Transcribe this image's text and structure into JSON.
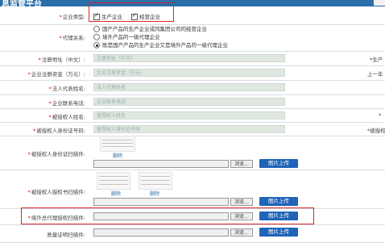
{
  "header": {
    "title": "息监管平台"
  },
  "form": {
    "enterprise_type": {
      "label": "企业类型:",
      "options": [
        "生产企业",
        "经营企业"
      ]
    },
    "agent_relation": {
      "label": "代理关系:",
      "options": [
        "国产产品的生产企业或同集团公司的经营企业",
        "境外产品的一级代理企业",
        "既是国产产品的生产企业又是境外产品的一级代理企业"
      ],
      "selected_index": 2
    },
    "reg_address": {
      "label": "注册地址（中文）:",
      "placeholder": "注册地址（中文）",
      "right_label": "生产"
    },
    "reg_capital": {
      "label": "企业注册资金（万元）:",
      "placeholder": "企业注册资金（万元）",
      "right_label": "上一年"
    },
    "legal_name": {
      "label": "法人代表姓名:",
      "placeholder": "法人代表姓名"
    },
    "phone": {
      "label": "企业联系电话:",
      "placeholder": "企业联系电话"
    },
    "authorized_name": {
      "label": "被授权人姓名:",
      "placeholder": "被授权人姓名"
    },
    "authorized_id": {
      "label": "被授权人身份证号码:",
      "placeholder": "被授权人身份证号码",
      "right_label": "被授权"
    },
    "id_attach": {
      "label": "被授权人身份证扫描件:",
      "delete": "删除",
      "browse": "浏览...",
      "upload": "图片上传"
    },
    "auth_attach": {
      "label": "被授权人授权书扫描件:",
      "delete": "删除",
      "browse": "浏览...",
      "upload": "图片上传"
    },
    "overseas_attach": {
      "label": "境外总代理授权扫描件:",
      "browse": "浏览...",
      "upload": "图片上传"
    },
    "quality_attach": {
      "label": "质量证明扫描件:",
      "browse": "浏览...",
      "upload": "图片上传"
    }
  }
}
